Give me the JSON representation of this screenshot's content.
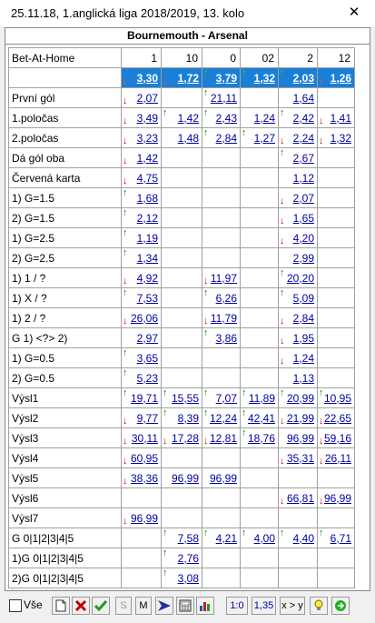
{
  "window": {
    "title": "25.11.18, 1.anglická liga 2018/2019, 13. kolo",
    "close": "✕"
  },
  "match": "Bournemouth - Arsenal",
  "header": {
    "bookmaker": "Bet-At-Home",
    "cols": [
      "1",
      "10",
      "0",
      "02",
      "2",
      "12"
    ]
  },
  "odds": [
    "3,30",
    "1,72",
    "3,79",
    "1,32",
    "2,03",
    "1,26"
  ],
  "odds_arrows": [
    "down",
    "down",
    "up",
    "up",
    "up",
    "down"
  ],
  "rows": [
    {
      "label": "První gól",
      "cells": [
        [
          "down",
          "2,07"
        ],
        null,
        [
          "up",
          "21,11"
        ],
        null,
        [
          null,
          "1,64"
        ],
        null
      ]
    },
    {
      "label": "1.poločas",
      "cells": [
        [
          "down",
          "3,49"
        ],
        [
          "up",
          "1,42"
        ],
        [
          "up",
          "2,43"
        ],
        [
          null,
          "1,24"
        ],
        [
          "up",
          "2,42"
        ],
        [
          "down",
          "1,41"
        ]
      ]
    },
    {
      "label": "2.poločas",
      "cells": [
        [
          "down",
          "3,23"
        ],
        [
          null,
          "1,48"
        ],
        [
          "up",
          "2,84"
        ],
        [
          "up",
          "1,27"
        ],
        [
          "down",
          "2,24"
        ],
        [
          "down",
          "1,32"
        ]
      ]
    },
    {
      "label": "Dá gól oba",
      "cells": [
        [
          "down",
          "1,42"
        ],
        null,
        null,
        null,
        [
          "up",
          "2,67"
        ],
        null
      ]
    },
    {
      "label": "Červená karta",
      "cells": [
        [
          "down",
          "4,75"
        ],
        null,
        null,
        null,
        [
          null,
          "1,12"
        ],
        null
      ]
    },
    {
      "label": "1) G=1.5",
      "cells": [
        [
          "up",
          "1,68"
        ],
        null,
        null,
        null,
        [
          "down",
          "2,07"
        ],
        null
      ]
    },
    {
      "label": "2) G=1.5",
      "cells": [
        [
          "up",
          "2,12"
        ],
        null,
        null,
        null,
        [
          "down",
          "1,65"
        ],
        null
      ]
    },
    {
      "label": "1) G=2.5",
      "cells": [
        [
          "up",
          "1,19"
        ],
        null,
        null,
        null,
        [
          "down",
          "4,20"
        ],
        null
      ]
    },
    {
      "label": "2) G=2.5",
      "cells": [
        [
          "up",
          "1,34"
        ],
        null,
        null,
        null,
        [
          null,
          "2,99"
        ],
        null
      ]
    },
    {
      "label": "1) 1 / ?",
      "cells": [
        [
          "down",
          "4,92"
        ],
        null,
        [
          "down",
          "11,97"
        ],
        null,
        [
          "up",
          "20,20"
        ],
        null
      ]
    },
    {
      "label": "1) X / ?",
      "cells": [
        [
          "up",
          "7,53"
        ],
        null,
        [
          "up",
          "6,26"
        ],
        null,
        [
          "up",
          "5,09"
        ],
        null
      ]
    },
    {
      "label": "1) 2 / ?",
      "cells": [
        [
          "down",
          "26,06"
        ],
        null,
        [
          "down",
          "11,79"
        ],
        null,
        [
          "down",
          "2,84"
        ],
        null
      ]
    },
    {
      "label": "G 1) <?> 2)",
      "cells": [
        [
          null,
          "2,97"
        ],
        null,
        [
          "up",
          "3,86"
        ],
        null,
        [
          "down",
          "1,95"
        ],
        null
      ]
    },
    {
      "label": "1) G=0.5",
      "cells": [
        [
          "up",
          "3,65"
        ],
        null,
        null,
        null,
        [
          "down",
          "1,24"
        ],
        null
      ]
    },
    {
      "label": "2) G=0.5",
      "cells": [
        [
          "up",
          "5,23"
        ],
        null,
        null,
        null,
        [
          null,
          "1,13"
        ],
        null
      ]
    },
    {
      "label": "Výsl1",
      "cells": [
        [
          "up",
          "19,71"
        ],
        [
          "up",
          "15,55"
        ],
        [
          "up",
          "7,07"
        ],
        [
          "up",
          "11,89"
        ],
        [
          "up",
          "20,99"
        ],
        [
          "up",
          "10,95"
        ]
      ]
    },
    {
      "label": "Výsl2",
      "cells": [
        [
          "down",
          "9,77"
        ],
        [
          "up",
          "8,39"
        ],
        [
          "up",
          "12,24"
        ],
        [
          "up",
          "42,41"
        ],
        [
          "down",
          "21,99"
        ],
        [
          "down",
          "22,65"
        ]
      ]
    },
    {
      "label": "Výsl3",
      "cells": [
        [
          "down",
          "30,11"
        ],
        [
          "down",
          "17,28"
        ],
        [
          "down",
          "12,81"
        ],
        [
          "up",
          "18,76"
        ],
        [
          null,
          "96,99"
        ],
        [
          "down",
          "59,16"
        ]
      ]
    },
    {
      "label": "Výsl4",
      "cells": [
        [
          "down",
          "60,95"
        ],
        null,
        null,
        null,
        [
          "down",
          "35,31"
        ],
        [
          "down",
          "26,11"
        ]
      ]
    },
    {
      "label": "Výsl5",
      "cells": [
        [
          "down",
          "38,36"
        ],
        [
          null,
          "96,99"
        ],
        [
          null,
          "96,99"
        ],
        null,
        null,
        null
      ]
    },
    {
      "label": "Výsl6",
      "cells": [
        null,
        null,
        null,
        null,
        [
          "down",
          "66,81"
        ],
        [
          "down",
          "96,99"
        ]
      ]
    },
    {
      "label": "Výsl7",
      "cells": [
        [
          "down",
          "96,99"
        ],
        null,
        null,
        null,
        null,
        null
      ]
    },
    {
      "label": "G 0|1|2|3|4|5",
      "cells": [
        null,
        [
          "up",
          "7,58"
        ],
        [
          "up",
          "4,21"
        ],
        [
          "up",
          "4,00"
        ],
        [
          "up",
          "4,40"
        ],
        [
          "up",
          "6,71"
        ]
      ]
    },
    {
      "label": "1)G 0|1|2|3|4|5",
      "cells": [
        null,
        [
          "up",
          "2,76"
        ],
        null,
        null,
        null,
        null
      ]
    },
    {
      "label": "2)G 0|1|2|3|4|5",
      "cells": [
        null,
        [
          "up",
          "3,08"
        ],
        null,
        null,
        null,
        null
      ]
    }
  ],
  "toolbar": {
    "all_label": "Vše",
    "s": "S",
    "m": "M",
    "score": "1:0",
    "odds": "1,35",
    "compare": "x > y"
  },
  "colors": {
    "odds_row": "#1a7fd6",
    "link": "#0000a0",
    "up": "#1a8f1a",
    "down": "#d40000"
  }
}
